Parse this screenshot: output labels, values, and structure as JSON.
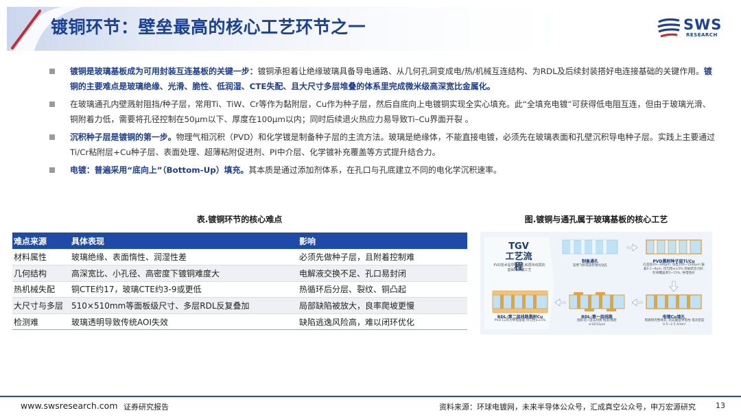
{
  "header": {
    "title": "镀铜环节：壁垒最高的核心工艺环节之一",
    "logo_name": "SWS",
    "logo_sub": "RESEARCH"
  },
  "bullets": [
    {
      "bold1": "镀铜是玻璃基板成为可用封装互连基板的关键一步：",
      "text1": "镀铜承担着让绝缘玻璃具备导电通路、从几何孔洞变成电/热/机械互连结构、为RDL及后续封装搭好电连接基础的关键作用。",
      "bold2": "镀铜的主要难点是玻璃绝缘、光滑、脆性、低润湿、CTE失配、且大尺寸多层堆叠的体系里完成微米级高深宽比金属化。",
      "text2": ""
    },
    {
      "bold1": "",
      "text1": "在玻璃通孔内壁溅射阻挡/种子层，常用Ti、TiW、Cr等作为黏附层，Cu作为种子层，然后自底向上电镀铜实现全实心填充。此“全填充电镀”可获得低电阻互连，但由于玻璃光滑、铜附着力低，需要将孔径控制在50μm以下、厚度在100μm以内；同时后续退火热应力易导致Ti–Cu界面开裂 。",
      "bold2": "",
      "text2": ""
    },
    {
      "bold1": "沉积种子层是镀铜的第一步。",
      "text1": "物理气相沉积（PVD）和化学镀是制备种子层的主流方法。玻璃是绝缘体，不能直接电镀，必须先在玻璃表面和孔壁沉积导电种子层。实践上主要通过Ti/Cr粘附层+Cu种子层、表面处理、超薄粘附促进剂、PI中介层、化学镀补充覆盖等方式提升结合力。",
      "bold2": "",
      "text2": ""
    },
    {
      "bold1": "电镀：普遍采用“底向上”（Bottom-Up）填充。",
      "text1": "其本质是通过添加剂体系，在孔口与孔底建立不同的电化学沉积速率。",
      "bold2": "",
      "text2": ""
    }
  ],
  "table": {
    "title": "表.镀铜环节的核心难点",
    "headers": [
      "难点来源",
      "具体表现",
      "影响"
    ],
    "rows": [
      [
        "材料属性",
        "玻璃绝缘、表面惰性、润湿性差",
        "必须先做种子层，且附着控制难"
      ],
      [
        "几何结构",
        "高深宽比、小孔径、高密度下镀铜难度大",
        "电解液交换不足、孔口易封闭"
      ],
      [
        "热机械失配",
        "铜CTE约17，玻璃CTE约3-9或更低",
        "热循环后分层、裂纹、铜凸起"
      ],
      [
        "大尺寸与多层",
        "510×510mm等面板级尺寸、多层RDL反复叠加",
        "局部缺陷被放大，良率爬坡更慢"
      ],
      [
        "检测难",
        "玻璃透明导致传统AOI失效",
        "缺陷逃逸风险高，难以闭环优化"
      ]
    ]
  },
  "figure": {
    "title": "图.镀铜与通孔属于玻璃基板的核心工艺",
    "tgv_head": "TGV 工艺流程",
    "tgv_desc": "PVD技术是导电通孔和再布线层的基础和关键工艺",
    "step1_label": "制备通孔",
    "step1_note": "常用飞秒或皮秒激光钻孔",
    "step2_label": "PVD溅射种子层Ti/Cu",
    "step2_note": "孔直径20~300μm, 深度100~1500μm 偏差0.1~8μm, 均匀性≤±5% 涂层结合力好, 阶梯覆盖率5~15%, 导电性好",
    "step3_label": "电镀Cu填孔",
    "step3_note": "电镀铜完整填充, 形成垂直导电柱 电流密度0.5~2.5 A/dm²",
    "step4_label": "RDL:第一层线路",
    "step4_note": "图形化+湿法刻蚀 线宽/线距≥10/12μm",
    "step5_label": "RDL:第二层线路溅射Cu",
    "step5_note": "PVD Cu作为导电基础 均匀性≤±5%"
  },
  "footer": {
    "url": "www.swsresearch.com",
    "label": "证券研究报告",
    "source": "资料来源：环球电镀网，未来半导体公众号，汇成真空公众号，申万宏源研究",
    "page": "13"
  },
  "colors": {
    "brand_blue": "#1a4196",
    "table_header": "#1e4aa8",
    "accent_red": "#d9232d"
  }
}
